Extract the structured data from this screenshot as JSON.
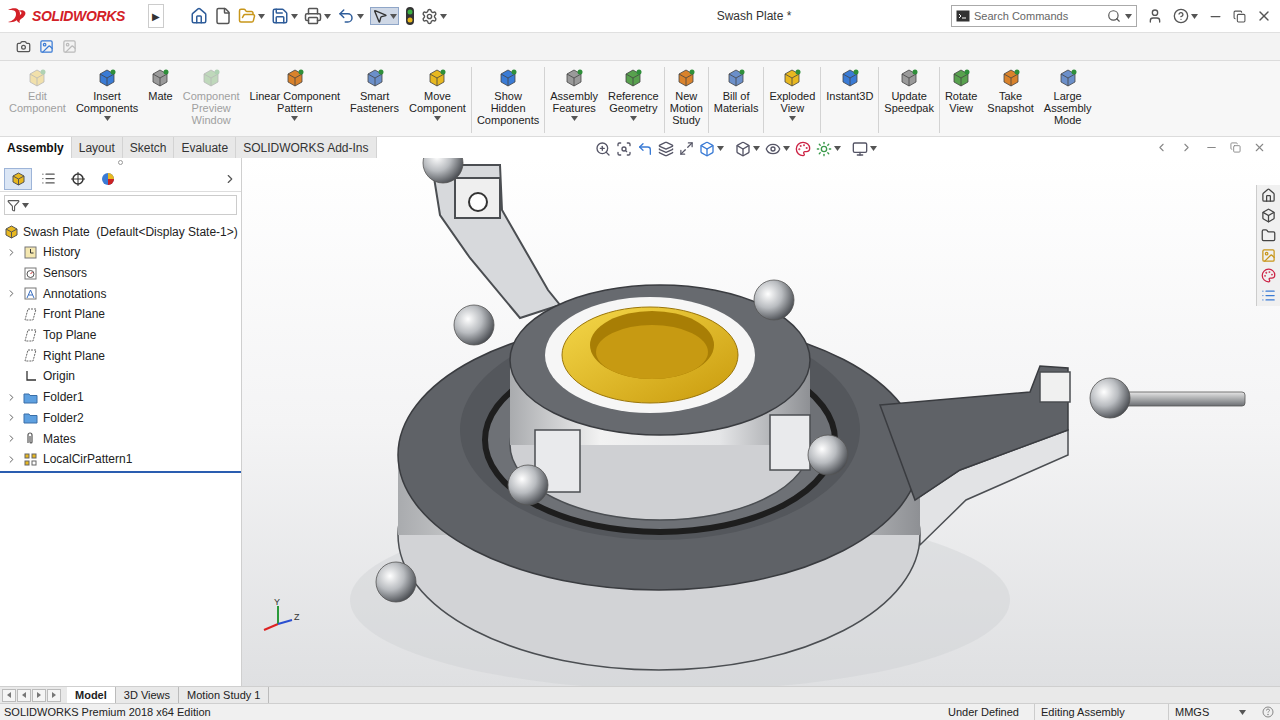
{
  "app": {
    "logo": "SOLIDWORKS",
    "menu_arrow": "▶"
  },
  "window": {
    "title": "Swash Plate *"
  },
  "search": {
    "placeholder": "Search Commands"
  },
  "ribbon": {
    "groups": [
      [
        {
          "label": [
            "Edit",
            "Component"
          ],
          "disabled": true,
          "dropdown": false
        },
        {
          "label": [
            "Insert",
            "Components"
          ],
          "disabled": false,
          "dropdown": true
        },
        {
          "label": [
            "Mate"
          ],
          "disabled": false,
          "dropdown": false
        },
        {
          "label": [
            "Component",
            "Preview",
            "Window"
          ],
          "disabled": true,
          "dropdown": false
        },
        {
          "label": [
            "Linear Component",
            "Pattern"
          ],
          "disabled": false,
          "dropdown": true
        },
        {
          "label": [
            "Smart",
            "Fasteners"
          ],
          "disabled": false,
          "dropdown": false
        },
        {
          "label": [
            "Move",
            "Component"
          ],
          "disabled": false,
          "dropdown": true
        }
      ],
      [
        {
          "label": [
            "Show",
            "Hidden",
            "Components"
          ],
          "disabled": false,
          "dropdown": false
        }
      ],
      [
        {
          "label": [
            "Assembly",
            "Features"
          ],
          "disabled": false,
          "dropdown": true
        },
        {
          "label": [
            "Reference",
            "Geometry"
          ],
          "disabled": false,
          "dropdown": true
        }
      ],
      [
        {
          "label": [
            "New",
            "Motion",
            "Study"
          ],
          "disabled": false,
          "dropdown": false
        }
      ],
      [
        {
          "label": [
            "Bill of",
            "Materials"
          ],
          "disabled": false,
          "dropdown": false
        }
      ],
      [
        {
          "label": [
            "Exploded",
            "View"
          ],
          "disabled": false,
          "dropdown": true
        }
      ],
      [
        {
          "label": [
            "Instant3D"
          ],
          "disabled": false,
          "dropdown": false
        }
      ],
      [
        {
          "label": [
            "Update",
            "Speedpak"
          ],
          "disabled": false,
          "dropdown": false
        }
      ],
      [
        {
          "label": [
            "Rotate",
            "View"
          ],
          "disabled": false,
          "dropdown": false
        },
        {
          "label": [
            "Take",
            "Snapshot"
          ],
          "disabled": false,
          "dropdown": false
        },
        {
          "label": [
            "Large",
            "Assembly",
            "Mode"
          ],
          "disabled": false,
          "dropdown": false
        }
      ]
    ]
  },
  "command_tabs": [
    {
      "label": "Assembly",
      "selected": true
    },
    {
      "label": "Layout",
      "selected": false
    },
    {
      "label": "Sketch",
      "selected": false
    },
    {
      "label": "Evaluate",
      "selected": false
    },
    {
      "label": "SOLIDWORKS Add-Ins",
      "selected": false
    }
  ],
  "feature_tree": {
    "root": "Swash Plate  (Default<Display State-1>)",
    "items": [
      {
        "label": "History",
        "kind": "history",
        "expandable": true
      },
      {
        "label": "Sensors",
        "kind": "sensor",
        "expandable": false
      },
      {
        "label": "Annotations",
        "kind": "annotation",
        "expandable": true
      },
      {
        "label": "Front Plane",
        "kind": "plane",
        "expandable": false
      },
      {
        "label": "Top Plane",
        "kind": "plane",
        "expandable": false
      },
      {
        "label": "Right Plane",
        "kind": "plane",
        "expandable": false
      },
      {
        "label": "Origin",
        "kind": "origin",
        "expandable": false
      },
      {
        "label": "Folder1",
        "kind": "folder",
        "expandable": true
      },
      {
        "label": "Folder2",
        "kind": "folder",
        "expandable": true
      },
      {
        "label": "Mates",
        "kind": "mates",
        "expandable": true
      },
      {
        "label": "LocalCirPattern1",
        "kind": "pattern",
        "expandable": true
      }
    ]
  },
  "viewport": {
    "triad": [
      "Y",
      "Z"
    ]
  },
  "bottom_tabs": [
    {
      "label": "Model",
      "selected": true
    },
    {
      "label": "3D Views",
      "selected": false
    },
    {
      "label": "Motion Study 1",
      "selected": false
    }
  ],
  "status_bar": {
    "product": "SOLIDWORKS Premium 2018 x64 Edition",
    "state": "Under Defined",
    "mode": "Editing Assembly",
    "units": "MMGS"
  }
}
